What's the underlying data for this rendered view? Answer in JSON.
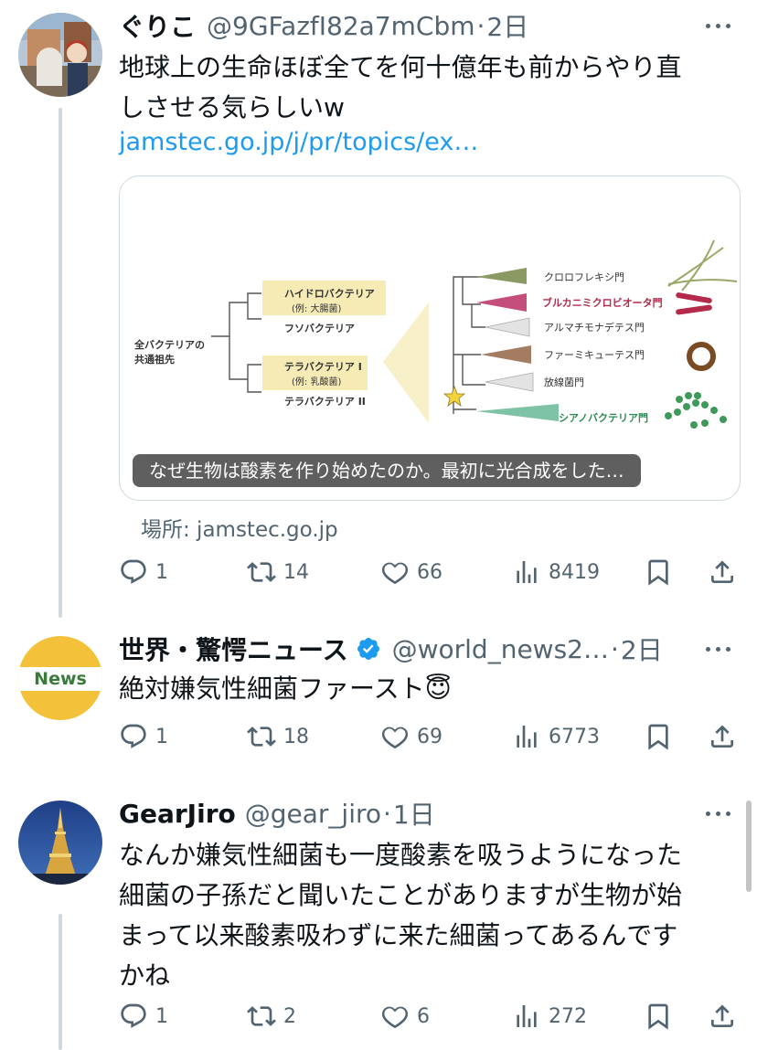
{
  "tweets": [
    {
      "name": "ぐりこ",
      "handle": "@9GFazfI82a7mCbm",
      "time": "2日",
      "text_lines": [
        "地球上の生命ほぼ全てを何十億年も前からやり直",
        "しさせる気らしいw"
      ],
      "link": "jamstec.go.jp/j/pr/topics/ex…",
      "card": {
        "caption": "なぜ生物は酸素を作り始めたのか。最初に光合成をした…",
        "source": "場所: jamstec.go.jp",
        "tree": {
          "root": [
            "全バクテリアの",
            "共通祖先"
          ],
          "groups": [
            {
              "name": "ハイドロバクテリア",
              "example": "(例: 大腸菌)"
            },
            {
              "name": "フソバクテリア",
              "example": ""
            },
            {
              "name": "テラバクテリア I",
              "example": "(例: 乳酸菌)"
            },
            {
              "name": "テラバクテリア II",
              "example": ""
            }
          ],
          "phyla": [
            {
              "name": "クロロフレキシ門",
              "color": "#8a9a62"
            },
            {
              "name": "ブルカニミクロビオータ門",
              "color": "#c44f7a"
            },
            {
              "name": "アルマチモナデテス門",
              "color": "#d9d9d9"
            },
            {
              "name": "ファーミキューテス門",
              "color": "#a47c62"
            },
            {
              "name": "放線菌門",
              "color": "#d9d9d9"
            },
            {
              "name": "シアノバクテリア門",
              "color": "#7ec3a6"
            }
          ]
        }
      },
      "stats": {
        "replies": "1",
        "retweets": "14",
        "likes": "66",
        "views": "8419"
      }
    },
    {
      "name": "世界・驚愕ニュース",
      "handle": "@world_news2…",
      "time": "2日",
      "avatar_text": "News",
      "text_lines": [
        "絶対嫌気性細菌ファースト😇"
      ],
      "stats": {
        "replies": "1",
        "retweets": "18",
        "likes": "69",
        "views": "6773"
      }
    },
    {
      "name": "GearJiro",
      "handle": "@gear_jiro",
      "time": "1日",
      "text_lines": [
        "なんか嫌気性細菌も一度酸素を吸うようになった",
        "細菌の子孫だと聞いたことがありますが生物が始",
        "まって以来酸素吸わずに来た細菌ってあるんです",
        "かね"
      ],
      "stats": {
        "replies": "1",
        "retweets": "2",
        "likes": "6",
        "views": "272"
      }
    }
  ],
  "colors": {
    "accent": "#1d9bf0",
    "muted": "#536471",
    "verified": "#1d9bf0"
  },
  "icons": [
    "reply-icon",
    "retweet-icon",
    "like-icon",
    "views-icon",
    "bookmark-icon",
    "share-icon",
    "more-icon",
    "verified-icon"
  ]
}
